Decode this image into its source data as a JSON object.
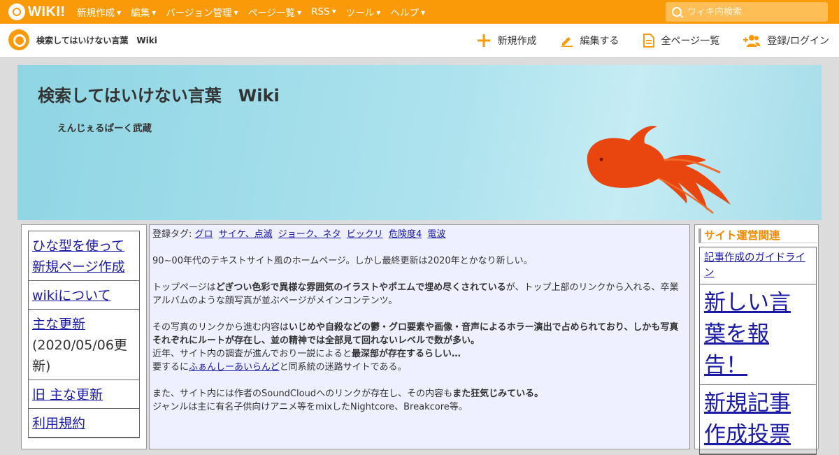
{
  "topbar": {
    "logo_text": "WIKI!",
    "menu": [
      {
        "label": "新規作成"
      },
      {
        "label": "編集"
      },
      {
        "label": "バージョン管理"
      },
      {
        "label": "ページ一覧"
      },
      {
        "label": "RSS"
      },
      {
        "label": "ツール"
      },
      {
        "label": "ヘルプ"
      }
    ],
    "search_placeholder": "ウィキ内検索"
  },
  "subbar": {
    "site_name": "検索してはいけない言葉　Wiki",
    "actions": [
      {
        "label": "新規作成",
        "icon": "plus-icon"
      },
      {
        "label": "編集する",
        "icon": "pencil-icon"
      },
      {
        "label": "全ページ一覧",
        "icon": "document-icon"
      },
      {
        "label": "登録/ログイン",
        "icon": "add-user-icon"
      }
    ]
  },
  "banner": {
    "title": "検索してはいけない言葉　Wiki",
    "subtitle": "えんじぇるぱーく武蔵",
    "image": "goldfish"
  },
  "left_nav": [
    {
      "label": "ひな型を使って新規ページ作成"
    },
    {
      "label": "wikiについて"
    },
    {
      "label": "主な更新",
      "date": "(2020/05/06更新)"
    },
    {
      "label": "旧 主な更新"
    },
    {
      "label": "利用規約"
    }
  ],
  "main": {
    "tags_label": "登録タグ:",
    "tags": [
      "グロ",
      "サイケ、点滅",
      "ジョーク、ネタ",
      "ビックリ",
      "危険度4",
      "電波"
    ],
    "p1": "90~00年代のテキストサイト風のホームページ。しかし最終更新は2020年とかなり新しい。",
    "p2_a": "トップページは",
    "p2_b": "どぎつい色彩で異様な雰囲気のイラストやポエムで埋め尽くされている",
    "p2_c": "が、トップ上部のリンクから入れる、卒業アルバムのような顔写真が並ぶページがメインコンテンツ。",
    "p3_a": "その写真のリンクから進む内容は",
    "p3_b": "いじめや自殺などの鬱・グロ要素や画像・音声によるホラー演出で占められており、しかも写真それぞれにルートが存在し、並の精神では全部見て回れないレベルで数が多い。",
    "p3_c": "近年、サイト内の調査が進んでおり一説によると",
    "p3_d": "最深部が存在するらしい…",
    "p3_e": "要するに",
    "p3_link": "ふぁんしーあいらんど",
    "p3_f": "と同系統の迷路サイトである。",
    "p4_a": "また、サイト内には作者のSoundCloudへのリンクが存在し、その内容も",
    "p4_b": "また狂気じみている。",
    "p4_c": "ジャンルは主に有名子供向けアニメ等をmixしたNightcore、Breakcore等。"
  },
  "right_side": {
    "heading": "サイト運営関連",
    "items": [
      {
        "label": "記事作成のガイドライン",
        "size": "small"
      },
      {
        "label": "新しい言葉を報告！",
        "size": "big"
      },
      {
        "label": "新規記事作成投票",
        "size": "big"
      }
    ]
  },
  "colors": {
    "accent": "#fb9a08",
    "link": "#1a1aa6",
    "side_heading": "#f28a00",
    "fish": "#e8450f"
  }
}
